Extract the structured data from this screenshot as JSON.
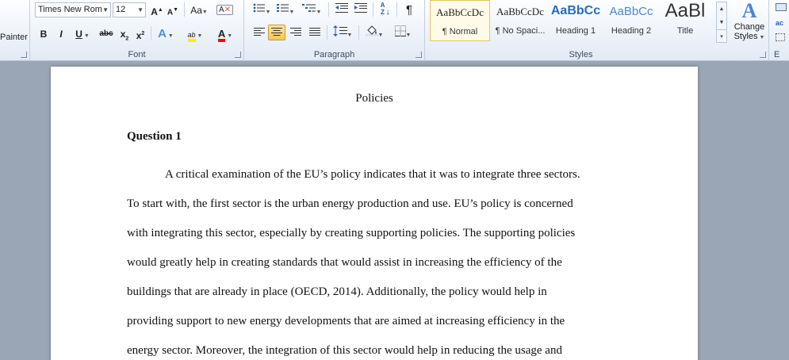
{
  "ribbon": {
    "clipboard": {
      "painter_label": "Painter"
    },
    "font": {
      "group_label": "Font",
      "font_name": "Times New Rom",
      "font_size": "12",
      "grow_label": "A",
      "shrink_label": "A",
      "change_case_label": "Aa",
      "clear_format_label": "A",
      "bold_label": "B",
      "italic_label": "I",
      "underline_label": "U",
      "strike_label": "abc",
      "subscript_label": "x",
      "superscript_label": "x",
      "text_effects_label": "A",
      "highlight_label": "ab",
      "font_color_label": "A"
    },
    "paragraph": {
      "group_label": "Paragraph",
      "pilcrow": "¶",
      "sort_label": "A Z"
    },
    "styles": {
      "group_label": "Styles",
      "tiles": [
        {
          "sample": "AaBbCcDc",
          "name": "¶ Normal"
        },
        {
          "sample": "AaBbCcDc",
          "name": "¶ No Spaci..."
        },
        {
          "sample": "AaBbCc",
          "name": "Heading 1"
        },
        {
          "sample": "AaBbCc",
          "name": "Heading 2"
        },
        {
          "sample": "AaBl",
          "name": "Title"
        }
      ],
      "change_styles_line1": "Change",
      "change_styles_line2": "Styles",
      "change_styles_icon": "A"
    },
    "editing": {
      "label": "E"
    }
  },
  "colors": {
    "accent_highlight": "#f8c45b",
    "heading_blue": "#2b6cb5",
    "font_red": "#e01010",
    "highlight_yellow": "#f7f100"
  },
  "document": {
    "title": "Policies",
    "heading": "Question 1",
    "lines": [
      "A critical examination of the EU’s policy indicates that it was to integrate three sectors.",
      "To start with, the first sector is the urban energy production and use. EU’s policy is concerned",
      "with integrating this sector, especially by creating supporting policies. The supporting policies",
      "would greatly help in creating standards that would assist in increasing the efficiency of the",
      "buildings that are already in place (OECD, 2014). Additionally, the policy would help in",
      "providing support to new energy developments that are aimed at increasing efficiency in the",
      "energy sector. Moreover, the integration of this sector would help in reducing the usage and"
    ]
  }
}
